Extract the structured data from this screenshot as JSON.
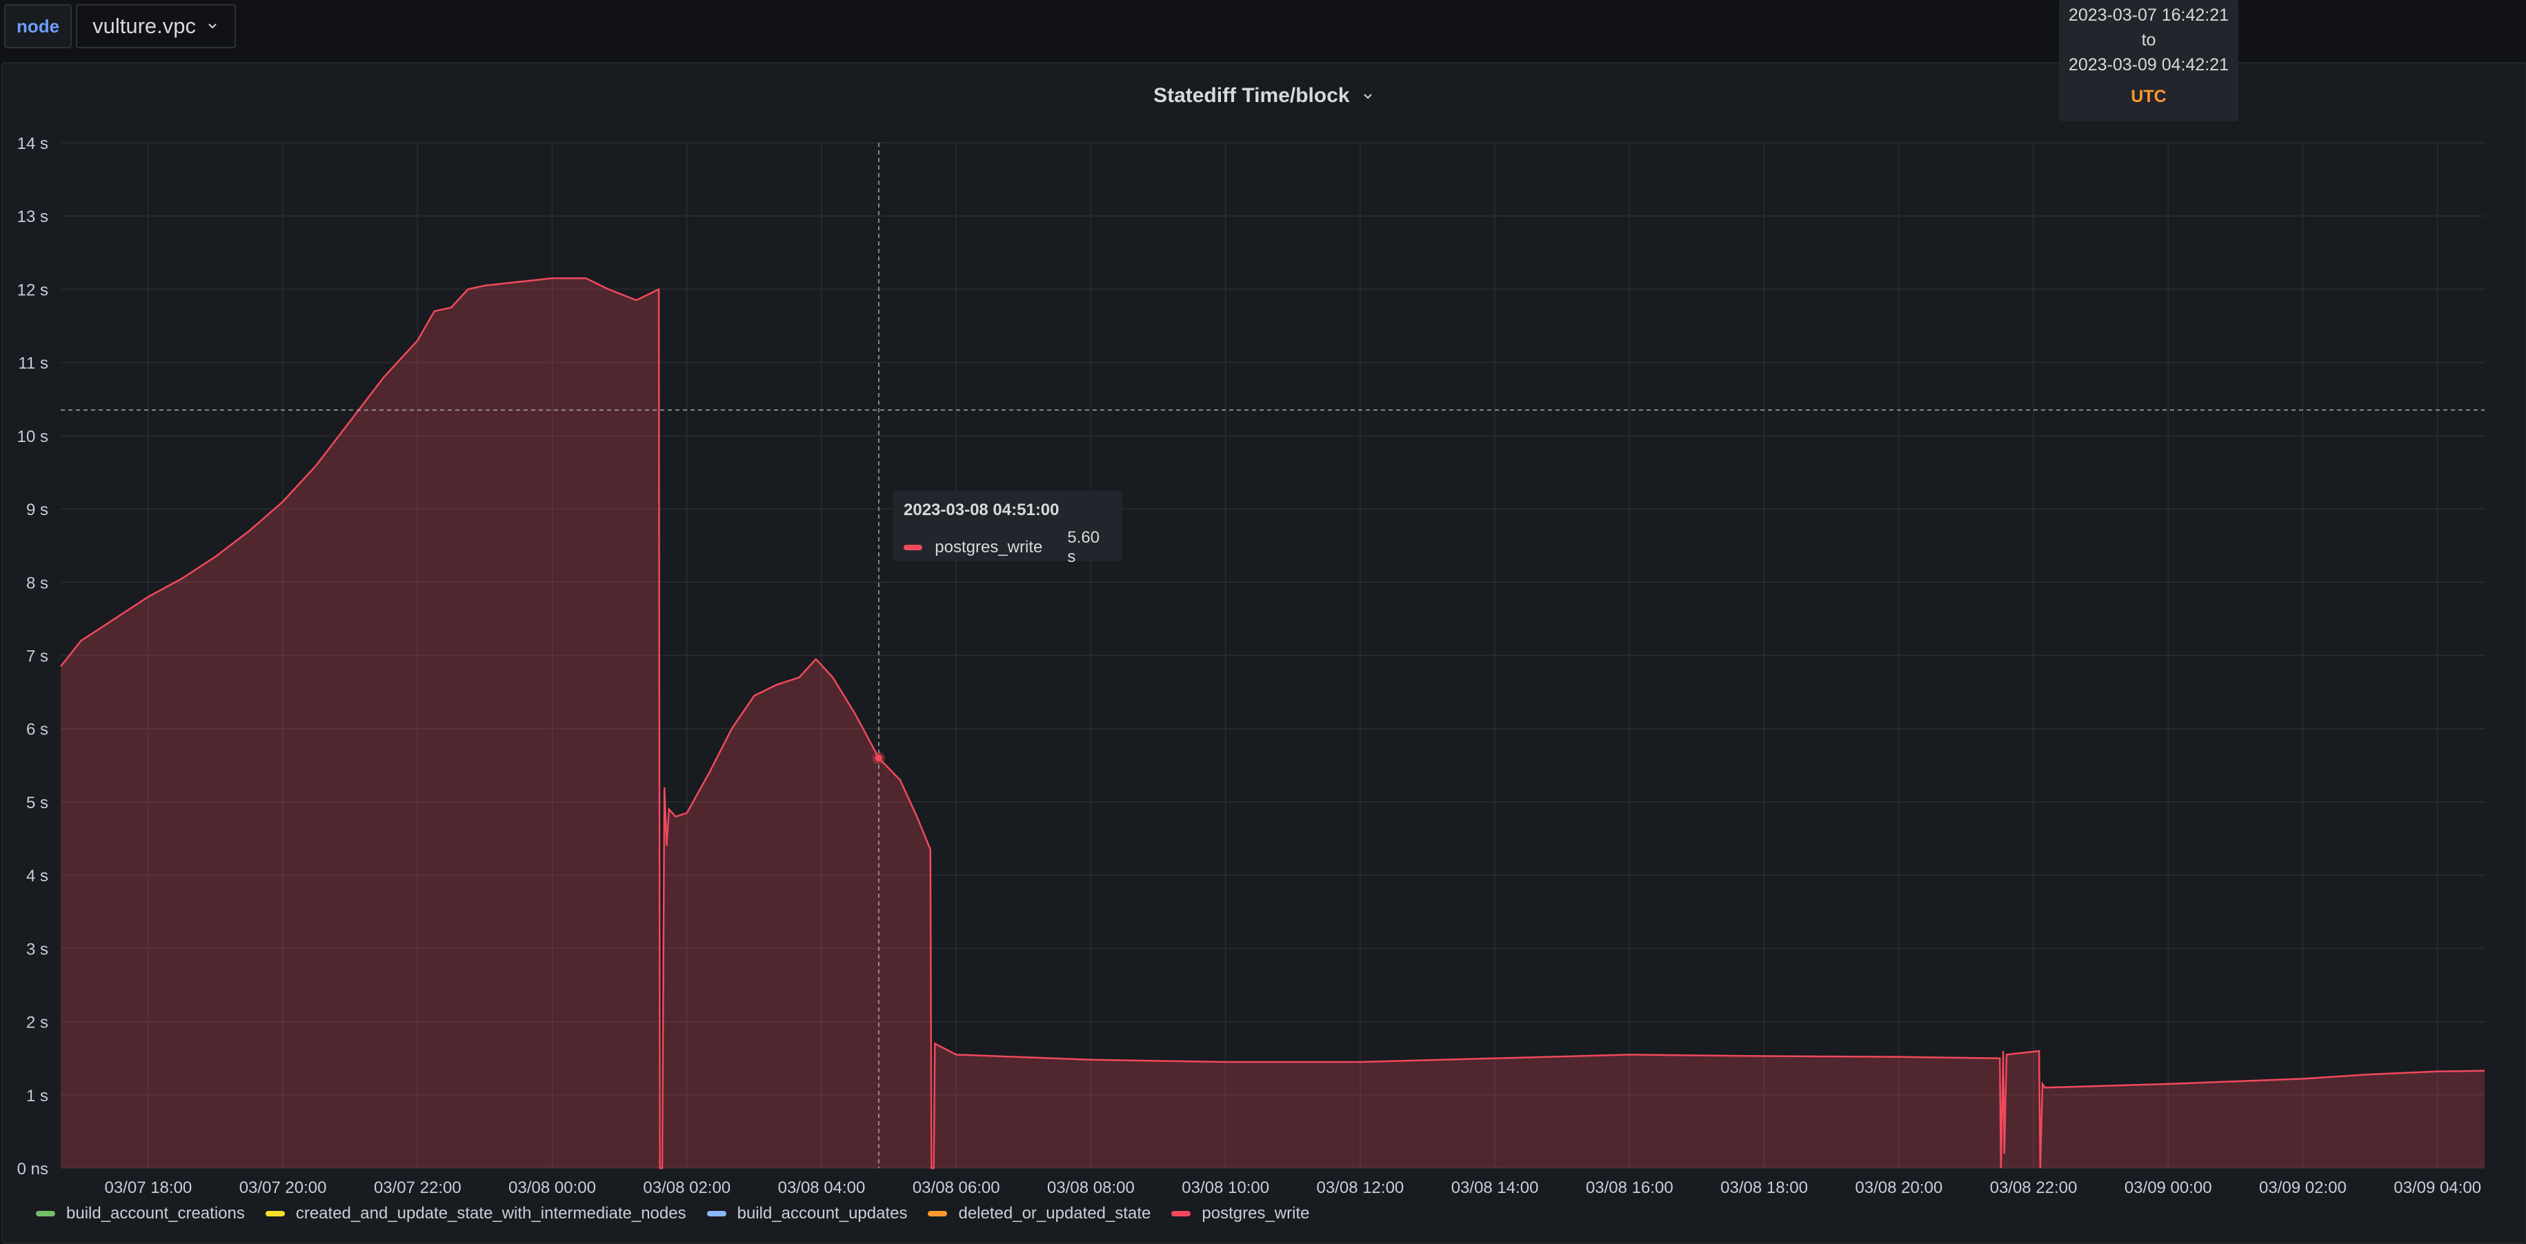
{
  "variables": {
    "label": "node",
    "value": "vulture.vpc"
  },
  "time_range_tooltip": {
    "from": "2023-03-07 16:42:21",
    "sep": "to",
    "to": "2023-03-09 04:42:21",
    "timezone": "UTC"
  },
  "panel": {
    "title": "Statediff Time/block"
  },
  "hover_tooltip": {
    "timestamp": "2023-03-08 04:51:00",
    "series": "postgres_write",
    "value": "5.60 s"
  },
  "legend": [
    {
      "name": "build_account_creations",
      "color": "#73bf69"
    },
    {
      "name": "created_and_update_state_with_intermediate_nodes",
      "color": "#fade2a"
    },
    {
      "name": "build_account_updates",
      "color": "#8ab8ff"
    },
    {
      "name": "deleted_or_updated_state",
      "color": "#ff9830"
    },
    {
      "name": "postgres_write",
      "color": "#f2495c"
    }
  ],
  "chart_data": {
    "type": "area",
    "title": "Statediff Time/block",
    "x_ticks": [
      "03/07 18:00",
      "03/07 20:00",
      "03/07 22:00",
      "03/08 00:00",
      "03/08 02:00",
      "03/08 04:00",
      "03/08 06:00",
      "03/08 08:00",
      "03/08 10:00",
      "03/08 12:00",
      "03/08 14:00",
      "03/08 16:00",
      "03/08 18:00",
      "03/08 20:00",
      "03/08 22:00",
      "03/09 00:00",
      "03/09 02:00",
      "03/09 04:00"
    ],
    "y_ticks": [
      "0 ns",
      "1 s",
      "2 s",
      "3 s",
      "4 s",
      "5 s",
      "6 s",
      "7 s",
      "8 s",
      "9 s",
      "10 s",
      "11 s",
      "12 s",
      "13 s",
      "14 s"
    ],
    "xlim": [
      "2023-03-07 16:42",
      "2023-03-09 04:42"
    ],
    "ylim": [
      0,
      14
    ],
    "y_unit": "s",
    "grid": true,
    "legend_position": "bottom-left",
    "crosshair": {
      "x": "2023-03-08 04:51",
      "y": 10.35
    },
    "series": [
      {
        "name": "postgres_write",
        "color": "#f2495c",
        "points": [
          [
            "2023-03-07 16:42",
            6.85
          ],
          [
            "2023-03-07 17:00",
            7.2
          ],
          [
            "2023-03-07 17:30",
            7.5
          ],
          [
            "2023-03-07 18:00",
            7.8
          ],
          [
            "2023-03-07 18:30",
            8.05
          ],
          [
            "2023-03-07 19:00",
            8.35
          ],
          [
            "2023-03-07 19:30",
            8.7
          ],
          [
            "2023-03-07 20:00",
            9.1
          ],
          [
            "2023-03-07 20:30",
            9.6
          ],
          [
            "2023-03-07 21:00",
            10.2
          ],
          [
            "2023-03-07 21:30",
            10.8
          ],
          [
            "2023-03-07 22:00",
            11.3
          ],
          [
            "2023-03-07 22:15",
            11.7
          ],
          [
            "2023-03-07 22:30",
            11.75
          ],
          [
            "2023-03-07 22:45",
            12.0
          ],
          [
            "2023-03-07 23:00",
            12.05
          ],
          [
            "2023-03-07 23:30",
            12.1
          ],
          [
            "2023-03-08 00:00",
            12.15
          ],
          [
            "2023-03-08 00:30",
            12.15
          ],
          [
            "2023-03-08 00:50",
            12.0
          ],
          [
            "2023-03-08 01:15",
            11.85
          ],
          [
            "2023-03-08 01:35",
            12.0
          ],
          [
            "2023-03-08 01:36",
            0.0
          ],
          [
            "2023-03-08 01:38",
            0.0
          ],
          [
            "2023-03-08 01:40",
            5.2
          ],
          [
            "2023-03-08 01:42",
            4.4
          ],
          [
            "2023-03-08 01:44",
            4.9
          ],
          [
            "2023-03-08 01:50",
            4.8
          ],
          [
            "2023-03-08 02:00",
            4.85
          ],
          [
            "2023-03-08 02:20",
            5.4
          ],
          [
            "2023-03-08 02:40",
            6.0
          ],
          [
            "2023-03-08 03:00",
            6.45
          ],
          [
            "2023-03-08 03:20",
            6.6
          ],
          [
            "2023-03-08 03:40",
            6.7
          ],
          [
            "2023-03-08 03:55",
            6.95
          ],
          [
            "2023-03-08 04:10",
            6.7
          ],
          [
            "2023-03-08 04:30",
            6.2
          ],
          [
            "2023-03-08 04:51",
            5.6
          ],
          [
            "2023-03-08 05:10",
            5.3
          ],
          [
            "2023-03-08 05:25",
            4.8
          ],
          [
            "2023-03-08 05:37",
            4.35
          ],
          [
            "2023-03-08 05:38",
            0.0
          ],
          [
            "2023-03-08 05:40",
            0.0
          ],
          [
            "2023-03-08 05:41",
            1.7
          ],
          [
            "2023-03-08 06:00",
            1.55
          ],
          [
            "2023-03-08 08:00",
            1.48
          ],
          [
            "2023-03-08 10:00",
            1.45
          ],
          [
            "2023-03-08 12:00",
            1.45
          ],
          [
            "2023-03-08 14:00",
            1.5
          ],
          [
            "2023-03-08 16:00",
            1.55
          ],
          [
            "2023-03-08 18:00",
            1.53
          ],
          [
            "2023-03-08 20:00",
            1.52
          ],
          [
            "2023-03-08 21:30",
            1.5
          ],
          [
            "2023-03-08 21:31",
            0.0
          ],
          [
            "2023-03-08 21:33",
            1.6
          ],
          [
            "2023-03-08 21:34",
            0.2
          ],
          [
            "2023-03-08 21:36",
            1.55
          ],
          [
            "2023-03-08 22:05",
            1.6
          ],
          [
            "2023-03-08 22:06",
            0.0
          ],
          [
            "2023-03-08 22:08",
            1.15
          ],
          [
            "2023-03-08 22:10",
            1.1
          ],
          [
            "2023-03-09 00:00",
            1.15
          ],
          [
            "2023-03-09 02:00",
            1.22
          ],
          [
            "2023-03-09 03:00",
            1.28
          ],
          [
            "2023-03-09 04:00",
            1.32
          ],
          [
            "2023-03-09 04:42",
            1.33
          ]
        ]
      }
    ]
  }
}
